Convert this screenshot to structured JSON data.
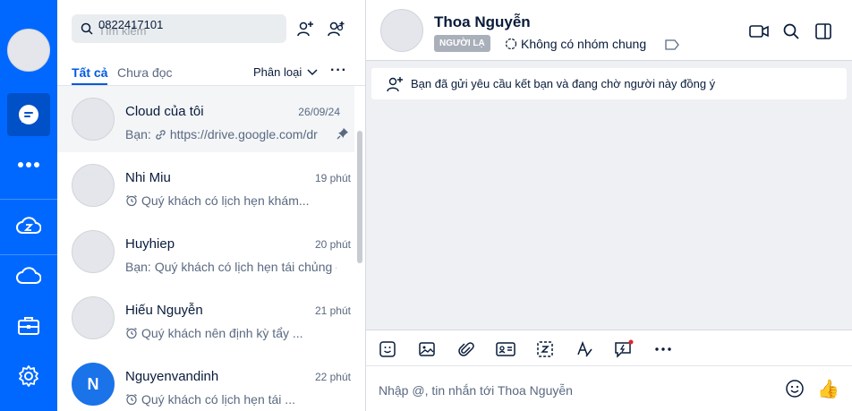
{
  "colors": {
    "brand": "#0068ff",
    "accent": "#005ae0",
    "avatar_blue": "#1a73e8",
    "notify_dot": "#e0262c"
  },
  "rail": {
    "icons": [
      "profile-avatar",
      "chat-icon",
      "more-icon",
      "zcloud-icon",
      "cloud-icon",
      "briefcase-icon",
      "settings-icon"
    ]
  },
  "search": {
    "placeholder": "Tìm kiếm",
    "value": "0822417101"
  },
  "tabs": {
    "all": "Tất cả",
    "unread": "Chưa đọc",
    "classify": "Phân loại",
    "more": "···"
  },
  "conversations": [
    {
      "name": "Cloud của tôi",
      "time": "26/09/24",
      "prefix": "Bạn:",
      "message": "https://drive.google.com/dr",
      "icon": "link-icon",
      "pinned": true
    },
    {
      "name": "Nhi Miu",
      "time": "19 phút",
      "prefix": "",
      "message": "Quý khách có lịch hẹn khám...",
      "icon": "alarm-icon",
      "pinned": false
    },
    {
      "name": "Huyhiep",
      "time": "20 phút",
      "prefix": "Bạn:",
      "message": "Quý khách có lịch hẹn tái chủng ch",
      "icon": "",
      "pinned": false
    },
    {
      "name": "Hiếu Nguyễn",
      "time": "21 phút",
      "prefix": "",
      "message": "Quý khách nên định kỳ tẩy ...",
      "icon": "alarm-icon",
      "pinned": false
    },
    {
      "name": "Nguyenvandinh",
      "time": "22 phút",
      "prefix": "",
      "message": "Quý khách có lịch hẹn tái ...",
      "icon": "alarm-icon",
      "pinned": false,
      "initial": "N"
    }
  ],
  "chat": {
    "title": "Thoa Nguyễn",
    "badge": "NGƯỜI LẠ",
    "groups": "Không có nhóm chung",
    "notice": "Bạn đã gửi yêu cầu kết bạn và đang chờ người này đồng ý",
    "composer_placeholder": "Nhập @, tin nhắn tới Thoa Nguyễn",
    "thumb": "👍"
  }
}
